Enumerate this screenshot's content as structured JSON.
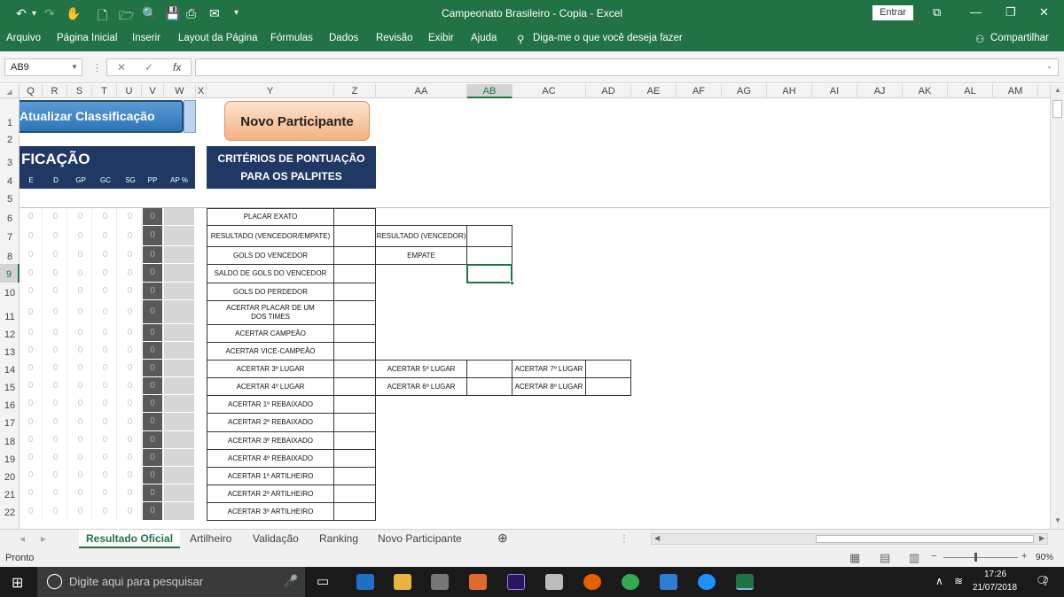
{
  "titlebar": {
    "title": "Campeonato Brasileiro - Copia  -  Excel",
    "entrar": "Entrar",
    "qa_icons": [
      "undo-icon",
      "redo-icon",
      "touch-mode-icon",
      "new-icon",
      "open-icon",
      "print-preview-icon",
      "save-icon",
      "print-icon",
      "email-icon",
      "customize-icon"
    ]
  },
  "ribbon": {
    "tabs": [
      "Arquivo",
      "Página Inicial",
      "Inserir",
      "Layout da Página",
      "Fórmulas",
      "Dados",
      "Revisão",
      "Exibir",
      "Ajuda"
    ],
    "tellme": "Diga-me o que você deseja fazer",
    "share": "Compartilhar"
  },
  "formula": {
    "namebox": "AB9",
    "value": ""
  },
  "columns": [
    "Q",
    "R",
    "S",
    "T",
    "U",
    "V",
    "W",
    "X",
    "Y",
    "Z",
    "AA",
    "AB",
    "AC",
    "AD",
    "AE",
    "AF",
    "AG",
    "AH",
    "AI",
    "AJ",
    "AK",
    "AL",
    "AM"
  ],
  "rows": [
    "1",
    "2",
    "3",
    "4",
    "5",
    "6",
    "7",
    "8",
    "9",
    "10",
    "11",
    "12",
    "13",
    "14",
    "15",
    "16",
    "17",
    "18",
    "19",
    "20",
    "21",
    "22"
  ],
  "sheet": {
    "btn_atualizar": "Atualizar Classificação",
    "btn_novo": "Novo Participante",
    "classificacao_header": "FICAÇÃO",
    "stat_headers": [
      "E",
      "D",
      "GP",
      "GC",
      "SG",
      "PP",
      "AP %"
    ],
    "zero": "0",
    "criterios_title": "CRITÉRIOS DE PONTUAÇÃO PARA OS PALPITES",
    "criteria": [
      "PLACAR EXATO",
      "RESULTADO (VENCEDOR/EMPATE)",
      "GOLS DO VENCEDOR",
      "SALDO DE GOLS DO VENCEDOR",
      "GOLS DO PERDEDOR",
      "ACERTAR PLACAR DE UM DOS TIMES",
      "ACERTAR CAMPEÃO",
      "ACERTAR VICE-CAMPEÃO",
      "ACERTAR 3º LUGAR",
      "ACERTAR 4º LUGAR",
      "ACERTAR 1º REBAIXADO",
      "ACERTAR 2º REBAIXADO",
      "ACERTAR 3º REBAIXADO",
      "ACERTAR 4º REBAIXADO",
      "ACERTAR 1º ARTILHEIRO",
      "ACERTAR 2º ARTILHEIRO",
      "ACERTAR 3º ARTILHEIRO"
    ],
    "extra_aa": [
      "RESULTADO (VENCEDOR)",
      "EMPATE"
    ],
    "extra_aa2": [
      "ACERTAR 5º LUGAR",
      "ACERTAR 6º LUGAR"
    ],
    "extra_ac": [
      "ACERTAR 7º LUGAR",
      "ACERTAR 8º LUGAR"
    ]
  },
  "sheettabs": {
    "tabs": [
      "Resultado Oficial",
      "Artilheiro",
      "Validação",
      "Ranking",
      "Novo Participante"
    ],
    "active": 0
  },
  "status": {
    "text": "Pronto",
    "zoom": "90%"
  },
  "taskbar": {
    "search_placeholder": "Digite aqui para pesquisar",
    "time": "17:26",
    "date": "21/07/2018",
    "notif_count": "2"
  }
}
